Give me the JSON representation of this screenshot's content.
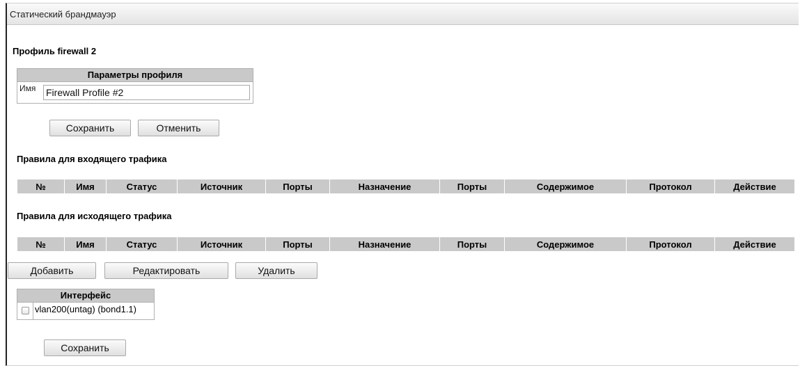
{
  "panel": {
    "title": "Статический брандмауэр"
  },
  "profile": {
    "heading": "Профиль firewall 2",
    "table_header": "Параметры профиля",
    "name_label": "Имя",
    "name_value": "Firewall Profile #2"
  },
  "buttons": {
    "save": "Сохранить",
    "cancel": "Отменить",
    "add": "Добавить",
    "edit": "Редактировать",
    "delete": "Удалить",
    "save_bottom": "Сохранить"
  },
  "incoming": {
    "title": "Правила для входящего трафика",
    "columns": [
      "№",
      "Имя",
      "Статус",
      "Источник",
      "Порты",
      "Назначение",
      "Порты",
      "Содержимое",
      "Протокол",
      "Действие"
    ]
  },
  "outgoing": {
    "title": "Правила для исходящего трафика",
    "columns": [
      "№",
      "Имя",
      "Статус",
      "Источник",
      "Порты",
      "Назначение",
      "Порты",
      "Содержимое",
      "Протокол",
      "Действие"
    ]
  },
  "interfaces": {
    "header": "Интерфейс",
    "items": [
      {
        "label": "vlan200(untag) (bond1.1)",
        "checked": false
      }
    ]
  }
}
